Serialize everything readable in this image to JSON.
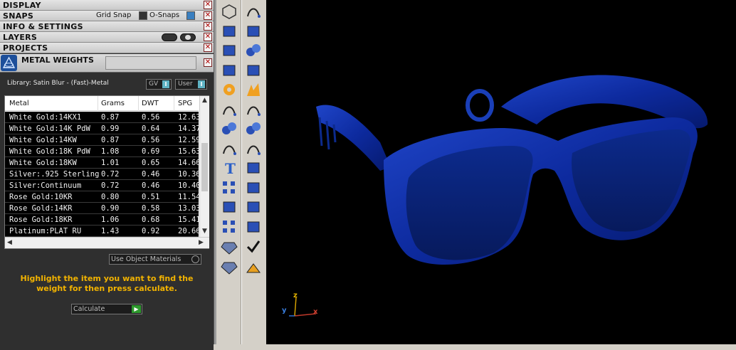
{
  "sections": [
    {
      "label": "DISPLAY"
    },
    {
      "label": "SNAPS"
    },
    {
      "label": "INFO & SETTINGS"
    },
    {
      "label": "LAYERS"
    },
    {
      "label": "PROJECTS"
    }
  ],
  "snaps": {
    "grid_snap_label": "Grid Snap",
    "osnaps_label": "O-Snaps"
  },
  "metal_weights": {
    "title": "METAL WEIGHTS",
    "library_label": "Library: Satin Blur - (Fast)-Metal",
    "gv_label": "GV",
    "user_label": "User",
    "columns": [
      "Metal",
      "Grams",
      "DWT",
      "SPG"
    ],
    "rows": [
      [
        "White Gold:14KX1",
        "0.87",
        "0.56",
        "12.63"
      ],
      [
        "White Gold:14K PdW",
        "0.99",
        "0.64",
        "14.37"
      ],
      [
        "White Gold:14KW",
        "0.87",
        "0.56",
        "12.59"
      ],
      [
        "White Gold:18K PdW",
        "1.08",
        "0.69",
        "15.63"
      ],
      [
        "White Gold:18KW",
        "1.01",
        "0.65",
        "14.66"
      ],
      [
        "Silver:.925 Sterling",
        "0.72",
        "0.46",
        "10.36"
      ],
      [
        "Silver:Continuum",
        "0.72",
        "0.46",
        "10.40"
      ],
      [
        "Rose Gold:10KR",
        "0.80",
        "0.51",
        "11.54"
      ],
      [
        "Rose Gold:14KR",
        "0.90",
        "0.58",
        "13.03"
      ],
      [
        "Rose Gold:18KR",
        "1.06",
        "0.68",
        "15.41"
      ],
      [
        "Platinum:PLAT RU",
        "1.43",
        "0.92",
        "20.66"
      ]
    ],
    "use_object_materials": "Use Object Materials",
    "hint": "Highlight the item you want to find the weight for then press calculate.",
    "calculate_label": "Calculate"
  },
  "axes": {
    "x": "x",
    "y": "y",
    "z": "z"
  },
  "colors": {
    "glasses": "#0a2a9a",
    "hint": "#f2b300"
  }
}
